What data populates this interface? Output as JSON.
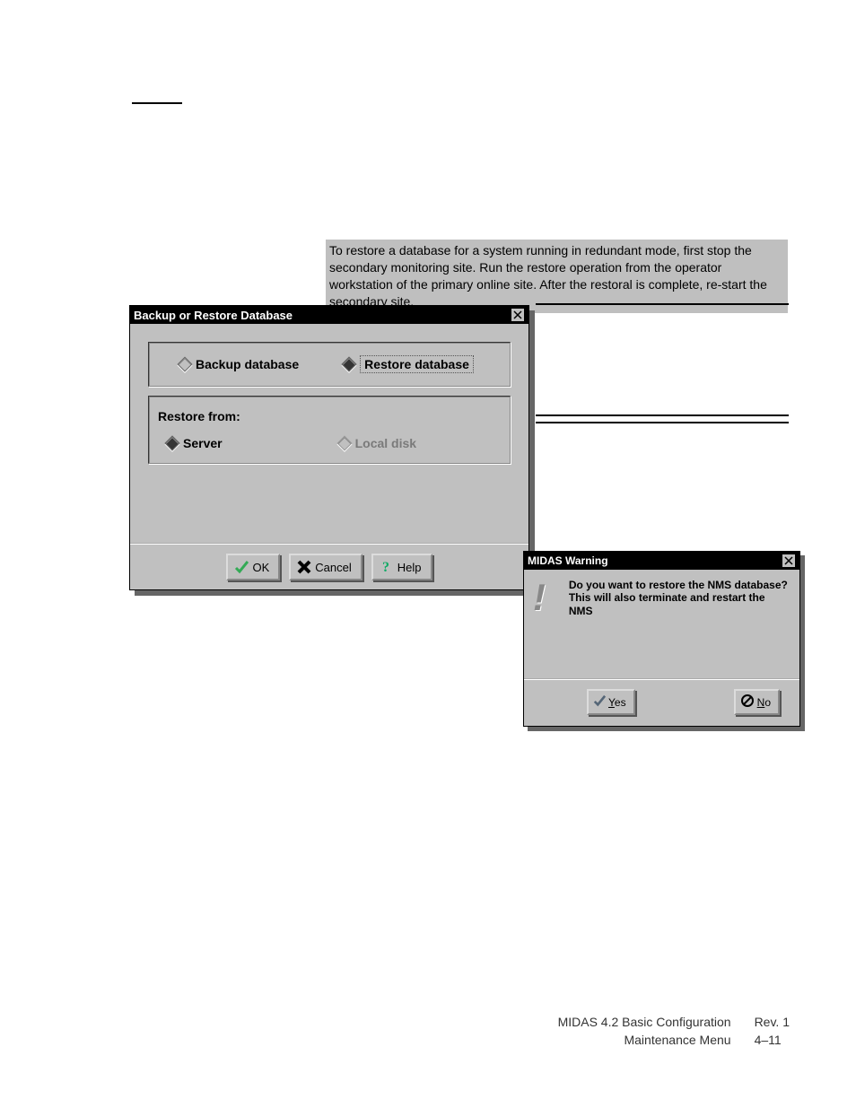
{
  "note_text": "To restore a database for a system running in redundant mode, first stop the secondary monitoring site. Run the restore operation from the operator workstation of the primary online site. After the restoral is complete, re-start the secondary site.",
  "dialog1": {
    "title": "Backup or Restore Database",
    "radio_backup": "Backup database",
    "radio_restore": "Restore database",
    "restore_from_label": "Restore from:",
    "radio_server": "Server",
    "radio_local": "Local disk",
    "ok": "OK",
    "cancel": "Cancel",
    "help": "Help"
  },
  "dialog2": {
    "title": "MIDAS Warning",
    "line1": "Do you want to restore the NMS database?",
    "line2": "This will also terminate and restart the NMS",
    "yes_u": "Y",
    "yes_tail": "es",
    "no_u": "N",
    "no_tail": "o"
  },
  "footer": {
    "left1": "MIDAS 4.2 Basic Configuration",
    "left2": "Maintenance Menu",
    "right1": "Rev. 1",
    "right2": "4–11"
  }
}
